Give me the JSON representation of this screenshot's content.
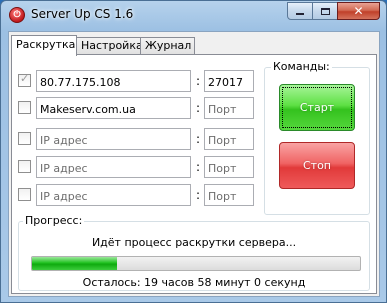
{
  "window": {
    "title": "Server Up CS 1.6",
    "icon": "app-power-icon"
  },
  "caption_buttons": {
    "minimize": "minimize-icon",
    "maximize": "maximize-icon",
    "close": "close-icon",
    "close_glyph": "✕"
  },
  "tabs": [
    {
      "label": "Раскрутка",
      "active": true
    },
    {
      "label": "Настройка",
      "active": false
    },
    {
      "label": "Журнал",
      "active": false
    }
  ],
  "servers": [
    {
      "checked": true,
      "ip": "80.77.175.108",
      "port": "27017"
    },
    {
      "checked": false,
      "ip": "Makeserv.com.ua",
      "port": ""
    },
    {
      "checked": false,
      "ip": "",
      "port": ""
    },
    {
      "checked": false,
      "ip": "",
      "port": ""
    },
    {
      "checked": false,
      "ip": "",
      "port": ""
    }
  ],
  "placeholders": {
    "ip": "IP адрес",
    "port": "Порт"
  },
  "separator": ":",
  "commands": {
    "legend": "Команды:",
    "start_label": "Старт",
    "stop_label": "Стоп",
    "start_color": "#34c21e",
    "stop_color": "#e13a3a"
  },
  "progress": {
    "legend": "Прогресс:",
    "status": "Идёт процесс раскрутки сервера...",
    "fraction": 0.26,
    "remaining": "Осталось:  19 часов 58 минут 0 секунд"
  }
}
